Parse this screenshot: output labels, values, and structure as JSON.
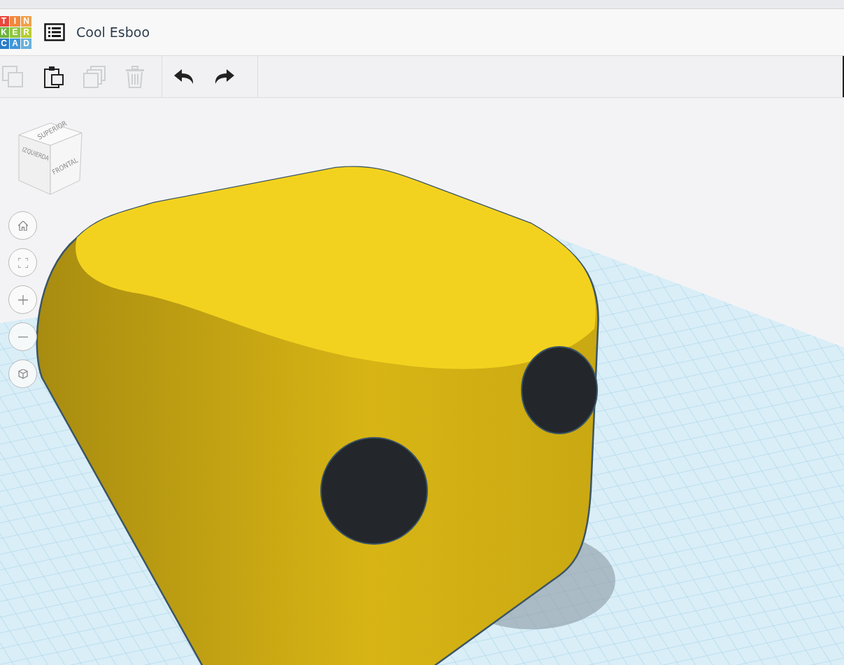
{
  "logo": {
    "letters": [
      {
        "char": "T",
        "color": "#e8473c"
      },
      {
        "char": "I",
        "color": "#f0883a"
      },
      {
        "char": "N",
        "color": "#f0a04b"
      },
      {
        "char": "K",
        "color": "#6fb43f"
      },
      {
        "char": "E",
        "color": "#8ec63f"
      },
      {
        "char": "R",
        "color": "#b6cd32"
      },
      {
        "char": "C",
        "color": "#2a7cc7"
      },
      {
        "char": "A",
        "color": "#3d96d8"
      },
      {
        "char": "D",
        "color": "#6ab0d8"
      }
    ]
  },
  "design_title": "Cool Esboo",
  "toolbar": [
    {
      "kind": "copy",
      "disabled": true
    },
    {
      "kind": "paste",
      "disabled": false
    },
    {
      "kind": "duplicate",
      "disabled": true
    },
    {
      "kind": "delete",
      "disabled": true
    },
    {
      "kind": "undo",
      "disabled": false
    },
    {
      "kind": "redo",
      "disabled": false
    }
  ],
  "view_cube": {
    "top": "SUPERIOR",
    "left": "IZQUIERDA",
    "front": "FRONTAL"
  },
  "view_controls": [
    {
      "kind": "home"
    },
    {
      "kind": "fit"
    },
    {
      "kind": "zoom_in"
    },
    {
      "kind": "zoom_out"
    },
    {
      "kind": "projection"
    }
  ]
}
